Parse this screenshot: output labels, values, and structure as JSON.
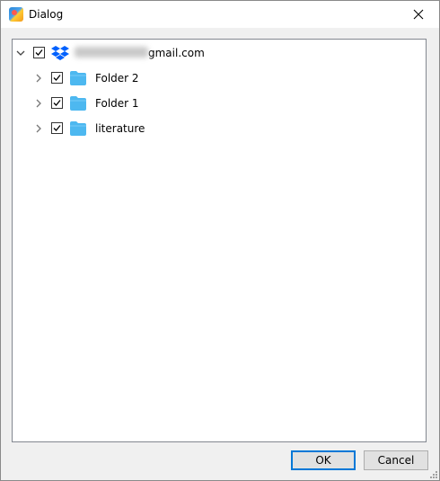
{
  "window": {
    "title": "Dialog"
  },
  "tree": {
    "root": {
      "label_visible": "gmail.com",
      "expanded": true,
      "checked": true,
      "icon": "dropbox-icon"
    },
    "children": [
      {
        "label": "Folder 2",
        "checked": true,
        "icon": "folder-icon"
      },
      {
        "label": "Folder 1",
        "checked": true,
        "icon": "folder-icon"
      },
      {
        "label": "literature",
        "checked": true,
        "icon": "folder-icon"
      }
    ]
  },
  "buttons": {
    "ok": "OK",
    "cancel": "Cancel"
  },
  "colors": {
    "folder": "#4db8f0",
    "dropbox": "#0061fe",
    "accent": "#0078d7"
  }
}
